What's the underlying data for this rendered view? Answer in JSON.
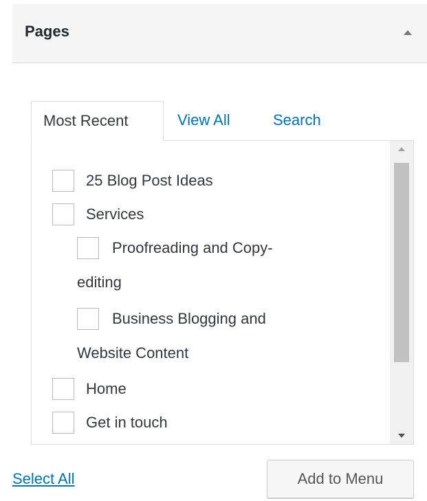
{
  "panel": {
    "title": "Pages"
  },
  "tabs": [
    {
      "label": "Most Recent",
      "active": true
    },
    {
      "label": "View All",
      "active": false
    },
    {
      "label": "Search",
      "active": false
    }
  ],
  "pages": [
    {
      "label": "25 Blog Post Ideas",
      "checked": false,
      "level": 0
    },
    {
      "label": "Services",
      "checked": false,
      "level": 0
    },
    {
      "label_line1": "Proofreading and Copy-",
      "label_line2": "editing",
      "checked": false,
      "level": 1
    },
    {
      "label_line1": "Business Blogging and",
      "label_line2": "Website Content",
      "checked": false,
      "level": 1
    },
    {
      "label": "Home",
      "checked": false,
      "level": 0
    },
    {
      "label": "Get in touch",
      "checked": false,
      "level": 0
    }
  ],
  "actions": {
    "select_all_label": "Select All",
    "add_to_menu_label": "Add to Menu"
  },
  "icons": {
    "collapse": "triangle-up-icon",
    "scroll_up": "scroll-up-arrow-icon",
    "scroll_down": "scroll-down-arrow-icon"
  },
  "colors": {
    "link": "#0073aa",
    "text": "#32373c",
    "header_bg": "#f5f5f5",
    "border": "#dcdcdc"
  }
}
